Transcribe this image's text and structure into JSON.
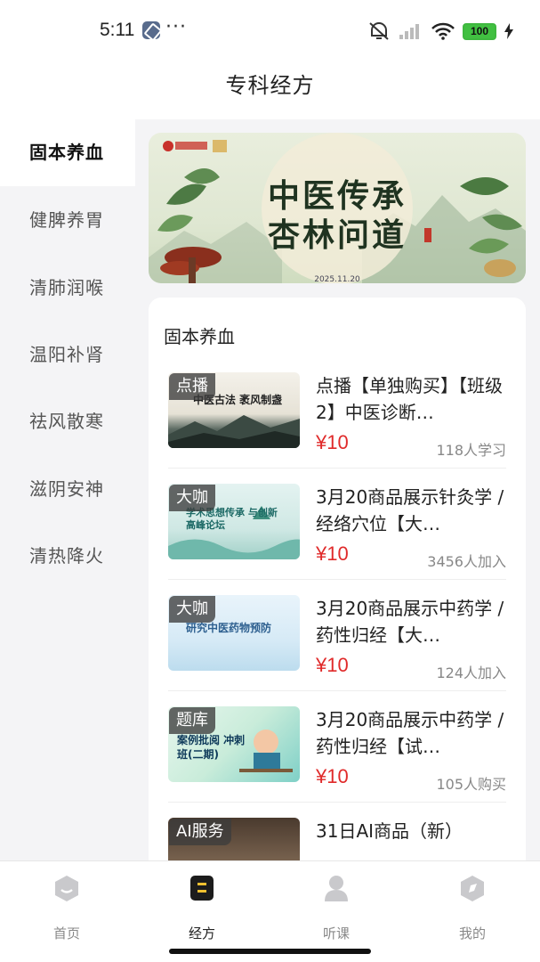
{
  "status_bar": {
    "time": "5:11",
    "dots": "···",
    "battery": "100"
  },
  "header": {
    "title": "专科经方"
  },
  "sidebar": {
    "items": [
      {
        "label": "固本养血",
        "active": true
      },
      {
        "label": "健脾养胃",
        "active": false
      },
      {
        "label": "清肺润喉",
        "active": false
      },
      {
        "label": "温阳补肾",
        "active": false
      },
      {
        "label": "祛风散寒",
        "active": false
      },
      {
        "label": "滋阴安神",
        "active": false
      },
      {
        "label": "清热降火",
        "active": false
      }
    ]
  },
  "banner": {
    "title_line1": "中医传承",
    "title_line2": "杏林问道",
    "date": "2025.11.20"
  },
  "section": {
    "title": "固本养血"
  },
  "courses": [
    {
      "tag": "点播",
      "name": "点播【单独购买】【班级2】中医诊断…",
      "price": "¥10",
      "stat": "118人学习",
      "thumb_text": "中医古法 袤风制盏"
    },
    {
      "tag": "大咖",
      "name": "3月20商品展示针灸学 / 经络穴位【大…",
      "price": "¥10",
      "stat": "3456人加入",
      "thumb_text": "学术思想传承 与创新高峰论坛"
    },
    {
      "tag": "大咖",
      "name": "3月20商品展示中药学 / 药性归经【大…",
      "price": "¥10",
      "stat": "124人加入",
      "thumb_text": "研究中医药物预防"
    },
    {
      "tag": "题库",
      "name": "3月20商品展示中药学 / 药性归经【试…",
      "price": "¥10",
      "stat": "105人购买",
      "thumb_text": "案例批阅 冲刺班(二期)"
    },
    {
      "tag": "AI服务",
      "name": "31日AI商品（新）",
      "price": "",
      "stat": ""
    }
  ],
  "tabbar": {
    "tabs": [
      {
        "label": "首页",
        "icon": "home-icon",
        "active": false
      },
      {
        "label": "经方",
        "icon": "formula-icon",
        "active": true
      },
      {
        "label": "听课",
        "icon": "person-icon",
        "active": false
      },
      {
        "label": "我的",
        "icon": "compass-icon",
        "active": false
      }
    ]
  },
  "colors": {
    "price": "#e02a2a",
    "active_tab": "#1c1c1c",
    "battery": "#41c041"
  }
}
